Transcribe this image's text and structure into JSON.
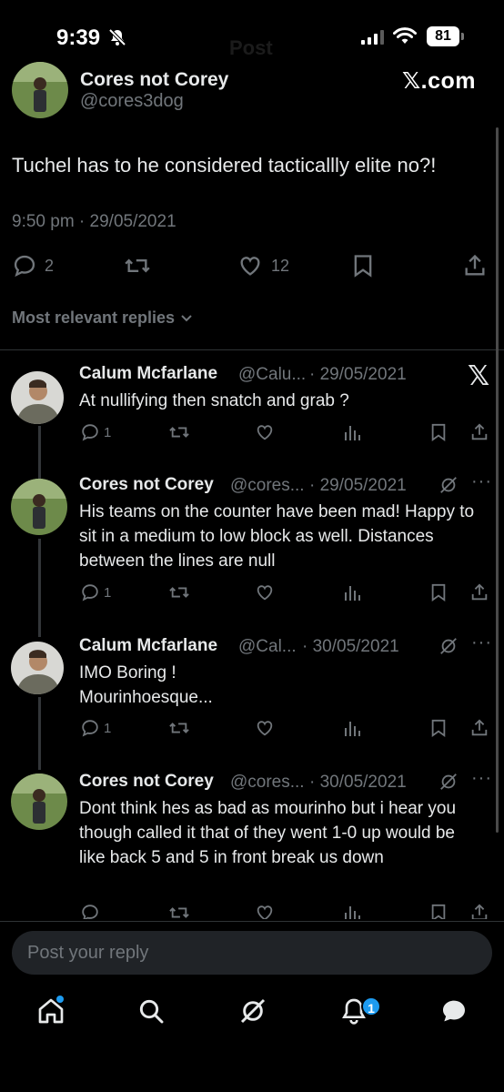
{
  "status_bar": {
    "time": "9:39",
    "battery": "81",
    "header_title": "Post"
  },
  "quoted_post": {
    "author_name": "Cores not Corey",
    "author_handle": "@cores3dog",
    "source_label": "𝕏.com",
    "body": "Tuchel has to he considered tacticallly elite no?!",
    "datetime": "9:50 pm · 29/05/2021",
    "reply_count": "2",
    "like_count": "12"
  },
  "sort_label": "Most relevant replies",
  "replies": [
    {
      "name": "Calum Mcfarlane",
      "handle": "@Calu...",
      "date": "· 29/05/2021",
      "text": "At nullifying then snatch and grab ?",
      "reply_count": "1",
      "icon": "x-logo-icon"
    },
    {
      "name": "Cores not Corey",
      "handle": "@cores...",
      "date": "· 29/05/2021",
      "text": "His teams on the counter have been mad! Happy to sit in a medium to low block as well. Distances between the lines are null",
      "reply_count": "1",
      "icon": "grok-icon"
    },
    {
      "name": "Calum Mcfarlane",
      "handle": "@Cal...",
      "date": "· 30/05/2021",
      "text_line1": "IMO Boring !",
      "text_line2": "Mourinhoesque...",
      "reply_count": "1",
      "icon": "grok-icon"
    },
    {
      "name": "Cores not Corey",
      "handle": "@cores...",
      "date": "· 30/05/2021",
      "text": "Dont think hes as bad as mourinho but i hear you though called it that of they went 1-0 up would be like back 5 and 5 in front break us down",
      "icon": "grok-icon"
    }
  ],
  "reply_box": {
    "placeholder": "Post your reply"
  },
  "tab_bar": {
    "notifications_badge": "1",
    "tabs": [
      "home-icon",
      "search-icon",
      "grok-icon",
      "notifications-icon",
      "messages-icon"
    ]
  },
  "colors": {
    "background": "#000000",
    "text": "#e7e9ea",
    "muted": "#71767b",
    "accent": "#1d9bf0",
    "input_bg": "#202327"
  }
}
